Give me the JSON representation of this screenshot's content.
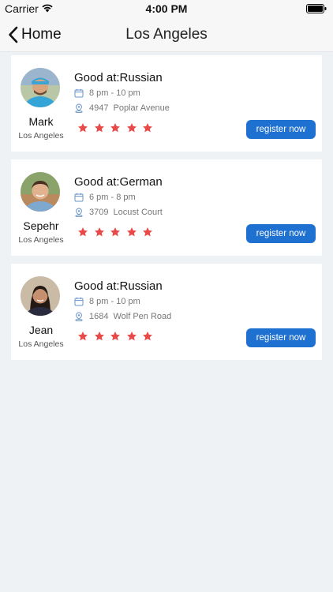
{
  "status_bar": {
    "carrier": "Carrier",
    "time": "4:00 PM"
  },
  "nav": {
    "back_label": "Home",
    "title": "Los Angeles"
  },
  "cards": [
    {
      "name": "Mark",
      "city": "Los Angeles",
      "good_at": "Good at:Russian",
      "time": "8 pm - 10 pm",
      "address_number": "4947",
      "address_street": "Poplar Avenue",
      "rating": 5,
      "button_label": "register now"
    },
    {
      "name": "Sepehr",
      "city": "Los Angeles",
      "good_at": "Good at:German",
      "time": "6 pm - 8 pm",
      "address_number": "3709",
      "address_street": "Locust Court",
      "rating": 5,
      "button_label": "register now"
    },
    {
      "name": "Jean",
      "city": "Los Angeles",
      "good_at": "Good at:Russian",
      "time": "8 pm - 10 pm",
      "address_number": "1684",
      "address_street": "Wolf Pen Road",
      "rating": 5,
      "button_label": "register now"
    }
  ],
  "colors": {
    "accent": "#1f71d1",
    "star": "#e84a4a",
    "background": "#eff2f5"
  },
  "icons": [
    "wifi-icon",
    "battery-icon",
    "back-chevron-icon",
    "calendar-icon",
    "location-pin-icon",
    "star-icon"
  ]
}
